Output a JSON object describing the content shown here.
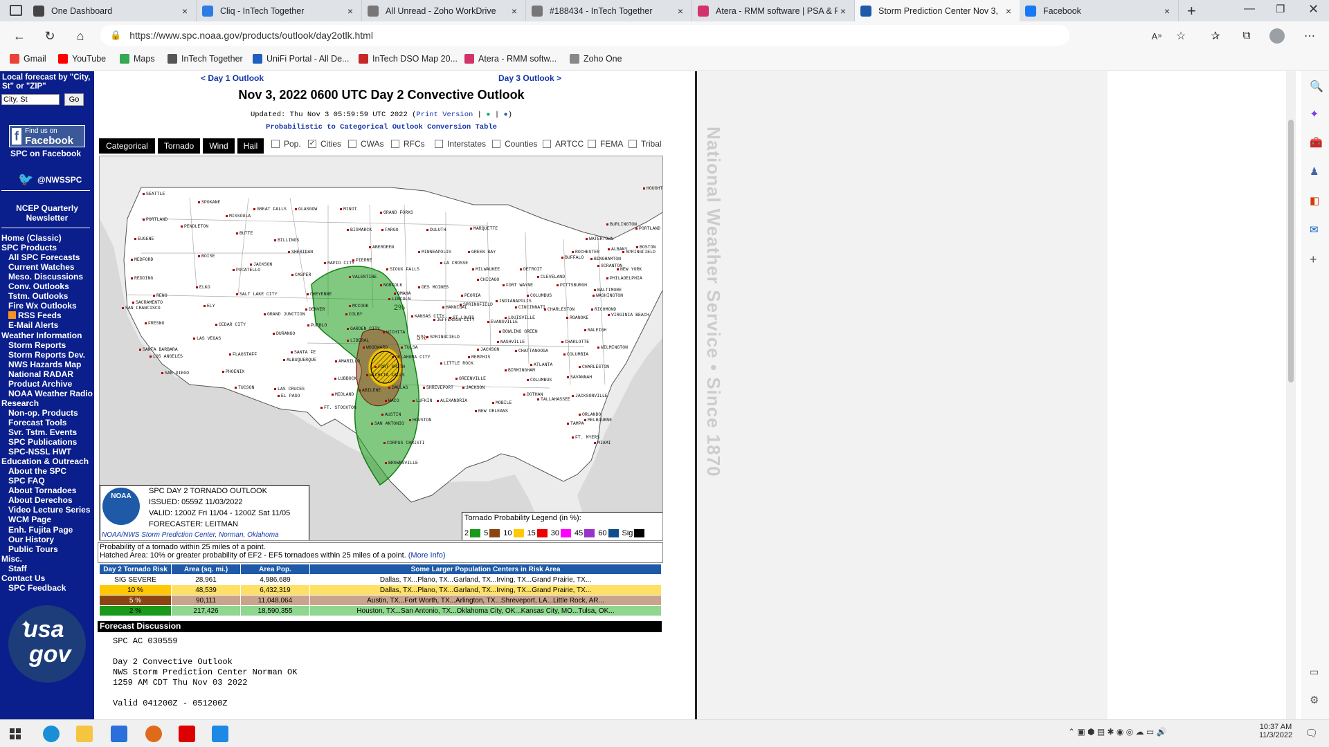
{
  "tabs": [
    {
      "title": "One Dashboard",
      "color": "#444"
    },
    {
      "title": "Cliq - InTech Together",
      "color": "#2d7be5"
    },
    {
      "title": "All Unread - Zoho WorkDrive",
      "color": "#777"
    },
    {
      "title": "#188434 - InTech Together",
      "color": "#777"
    },
    {
      "title": "Atera - RMM software | PSA & R",
      "color": "#d2336b"
    },
    {
      "title": "Storm Prediction Center Nov 3,",
      "color": "#1e5aa8"
    },
    {
      "title": "Facebook",
      "color": "#1877f2"
    }
  ],
  "url": "https://www.spc.noaa.gov/products/outlook/day2otlk.html",
  "bookmarks": [
    {
      "label": "Gmail",
      "color": "#ea4335"
    },
    {
      "label": "YouTube",
      "color": "#ff0000"
    },
    {
      "label": "Maps",
      "color": "#34a853"
    },
    {
      "label": "InTech Together",
      "color": "#555"
    },
    {
      "label": "UniFi Portal - All De...",
      "color": "#1f5fbf"
    },
    {
      "label": "InTech DSO Map 20...",
      "color": "#c62828"
    },
    {
      "label": "Atera - RMM softw...",
      "color": "#d2336b"
    },
    {
      "label": "Zoho One",
      "color": "#888"
    }
  ],
  "leftnav": {
    "local_label": "Local forecast by \"City, St\" or \"ZIP\"",
    "search_value": "City, St",
    "go": "Go",
    "fb_line1": "Find us on",
    "fb_line2": "Facebook",
    "fb_caption": "SPC on Facebook",
    "twitter": "@NWSSPC",
    "ncep1": "NCEP Quarterly",
    "ncep2": "Newsletter",
    "items": [
      {
        "t": "Home (Classic)",
        "i": 0
      },
      {
        "t": "SPC Products",
        "i": 0
      },
      {
        "t": "All SPC Forecasts",
        "i": 1
      },
      {
        "t": "Current Watches",
        "i": 1
      },
      {
        "t": "Meso. Discussions",
        "i": 1
      },
      {
        "t": "Conv. Outlooks",
        "i": 1
      },
      {
        "t": "Tstm. Outlooks",
        "i": 1
      },
      {
        "t": "Fire Wx Outlooks",
        "i": 1
      },
      {
        "t": "RSS Feeds",
        "i": 1
      },
      {
        "t": "E-Mail Alerts",
        "i": 1
      },
      {
        "t": "Weather Information",
        "i": 0
      },
      {
        "t": "Storm Reports",
        "i": 1
      },
      {
        "t": "Storm Reports Dev.",
        "i": 1
      },
      {
        "t": "NWS Hazards Map",
        "i": 1
      },
      {
        "t": "National RADAR",
        "i": 1
      },
      {
        "t": "Product Archive",
        "i": 1
      },
      {
        "t": "NOAA Weather Radio",
        "i": 1
      },
      {
        "t": "Research",
        "i": 0
      },
      {
        "t": "Non-op. Products",
        "i": 1
      },
      {
        "t": "Forecast Tools",
        "i": 1
      },
      {
        "t": "Svr. Tstm. Events",
        "i": 1
      },
      {
        "t": "SPC Publications",
        "i": 1
      },
      {
        "t": "SPC-NSSL HWT",
        "i": 1
      },
      {
        "t": "Education & Outreach",
        "i": 0
      },
      {
        "t": "About the SPC",
        "i": 1
      },
      {
        "t": "SPC FAQ",
        "i": 1
      },
      {
        "t": "About Tornadoes",
        "i": 1
      },
      {
        "t": "About Derechos",
        "i": 1
      },
      {
        "t": "Video Lecture Series",
        "i": 1
      },
      {
        "t": "WCM Page",
        "i": 1
      },
      {
        "t": "Enh. Fujita Page",
        "i": 1
      },
      {
        "t": "Our History",
        "i": 1
      },
      {
        "t": "Public Tours",
        "i": 1
      },
      {
        "t": "Misc.",
        "i": 0
      },
      {
        "t": "Staff",
        "i": 1
      },
      {
        "t": "Contact Us",
        "i": 0
      },
      {
        "t": "SPC Feedback",
        "i": 1
      }
    ],
    "usagov1": "usa",
    "usagov2": "gov"
  },
  "main": {
    "prev": "< Day 1 Outlook",
    "next": "Day 3 Outlook >",
    "title": "Nov 3, 2022 0600 UTC Day 2 Convective Outlook",
    "updated": "Updated: Thu Nov 3 05:59:59 UTC 2022 (",
    "print": "Print Version",
    "conv": "Probabilistic to Categorical Outlook Conversion Table",
    "buttons": [
      "Categorical",
      "Tornado",
      "Wind",
      "Hail"
    ],
    "checks": [
      {
        "label": "Pop.",
        "checked": false
      },
      {
        "label": "Cities",
        "checked": true
      },
      {
        "label": "CWAs",
        "checked": false
      },
      {
        "label": "RFCs",
        "checked": false
      },
      {
        "label": "Interstates",
        "checked": false
      },
      {
        "label": "Counties",
        "checked": false
      },
      {
        "label": "ARTCC",
        "checked": false
      },
      {
        "label": "FEMA",
        "checked": false
      },
      {
        "label": "Tribal",
        "checked": false
      }
    ],
    "infobox": {
      "l1": "SPC DAY 2 TORNADO OUTLOOK",
      "l2": "ISSUED: 0559Z 11/03/2022",
      "l3": "VALID: 1200Z Fri 11/04 - 1200Z Sat 11/05",
      "l4": "FORECASTER: LEITMAN",
      "l5": "NOAA/NWS Storm Prediction Center, Norman, Oklahoma",
      "noaa": "NOAA"
    },
    "legend": {
      "title": "Tornado Probability Legend (in %):",
      "items": [
        {
          "v": "2",
          "c": "#1a9a1a"
        },
        {
          "v": "5",
          "c": "#8b4513"
        },
        {
          "v": "10",
          "c": "#ffc800"
        },
        {
          "v": "15",
          "c": "#ee0000"
        },
        {
          "v": "30",
          "c": "#ff00ff"
        },
        {
          "v": "45",
          "c": "#9932cc"
        },
        {
          "v": "60",
          "c": "#104e8b"
        },
        {
          "v": "Sig",
          "c": "#000000"
        }
      ]
    },
    "map_labels": {
      "p2": "2%",
      "p5": "5%"
    },
    "desc1": "Probability of a tornado within 25 miles of a point.",
    "desc2": "Hatched Area: 10% or greater probability of EF2 - EF5 tornadoes within 25 miles of a point.",
    "more": "(More Info)",
    "table": {
      "headers": [
        "Day 2 Tornado Risk",
        "Area (sq. mi.)",
        "Area Pop.",
        "Some Larger Population Centers in Risk Area"
      ],
      "rows": [
        {
          "risk": "SIG SEVERE",
          "area": "28,961",
          "pop": "4,986,689",
          "centers": "Dallas, TX...Plano, TX...Garland, TX...Irving, TX...Grand Prairie, TX...",
          "bg": "#ffffff",
          "fg": "#000"
        },
        {
          "risk": "10 %",
          "area": "48,539",
          "pop": "6,432,319",
          "centers": "Dallas, TX...Plano, TX...Garland, TX...Irving, TX...Grand Prairie, TX...",
          "bg": "#ffe066",
          "fg": "#000"
        },
        {
          "risk": "5 %",
          "area": "90,111",
          "pop": "11,048,064",
          "centers": "Austin, TX...Fort Worth, TX...Arlington, TX...Shreveport, LA...Little Rock, AR...",
          "bg": "#c8a48c",
          "fg": "#000"
        },
        {
          "risk": "2 %",
          "area": "217,426",
          "pop": "18,590,355",
          "centers": "Houston, TX...San Antonio, TX...Oklahoma City, OK...Kansas City, MO...Tulsa, OK...",
          "bg": "#8fd68f",
          "fg": "#000"
        }
      ],
      "riskcolors": [
        "#ffffff",
        "#ffc800",
        "#8b4513",
        "#1a9a1a"
      ]
    },
    "disc_head": "Forecast Discussion",
    "disc": [
      "SPC AC 030559",
      "",
      "Day 2 Convective Outlook",
      "NWS Storm Prediction Center Norman OK",
      "1259 AM CDT Thu Nov 03 2022",
      "",
      "Valid 041200Z - 051200Z"
    ],
    "vertical": "National Weather Service • Since 1870"
  },
  "cities": [
    [
      "SEATTLE",
      210,
      178
    ],
    [
      "SPOKANE",
      290,
      190
    ],
    [
      "MISSOULA",
      330,
      210
    ],
    [
      "GREAT FALLS",
      370,
      200
    ],
    [
      "GLASGOW",
      430,
      200
    ],
    [
      "MINOT",
      495,
      200
    ],
    [
      "GRAND FORKS",
      553,
      205
    ],
    [
      "HOUGHTON",
      933,
      170
    ],
    [
      "PORTLAND",
      210,
      215
    ],
    [
      "PENDLETON",
      265,
      225
    ],
    [
      "BUTTE",
      345,
      235
    ],
    [
      "BILLINGS",
      400,
      245
    ],
    [
      "BISMARCK",
      505,
      230
    ],
    [
      "FARGO",
      555,
      230
    ],
    [
      "DULUTH",
      620,
      230
    ],
    [
      "MARQUETTE",
      683,
      228
    ],
    [
      "BURLINGTON",
      880,
      222
    ],
    [
      "PORTLAND",
      922,
      228
    ],
    [
      "EUGENE",
      198,
      243
    ],
    [
      "SHERIDAN",
      420,
      262
    ],
    [
      "ABERDEEN",
      537,
      255
    ],
    [
      "GREEN BAY",
      680,
      262
    ],
    [
      "WATERTOWN",
      850,
      243
    ],
    [
      "BOSTON",
      923,
      255
    ],
    [
      "MEDFORD",
      193,
      273
    ],
    [
      "BOISE",
      290,
      268
    ],
    [
      "JACKSON",
      365,
      280
    ],
    [
      "POCATELLO",
      340,
      288
    ],
    [
      "RAPID CITY",
      472,
      278
    ],
    [
      "PIERRE",
      513,
      274
    ],
    [
      "MINNEAPOLIS",
      608,
      262
    ],
    [
      "ROCHESTER",
      830,
      262
    ],
    [
      "ALBANY",
      882,
      258
    ],
    [
      "SPRINGFIELD",
      903,
      262
    ],
    [
      "BUFFALO",
      815,
      270
    ],
    [
      "BINGHAMTON",
      857,
      272
    ],
    [
      "SIOUX FALLS",
      562,
      287
    ],
    [
      "LA CROSSE",
      640,
      278
    ],
    [
      "MILWAUKEE",
      686,
      287
    ],
    [
      "DETROIT",
      755,
      287
    ],
    [
      "SCRANTON",
      867,
      282
    ],
    [
      "NEW YORK",
      895,
      287
    ],
    [
      "REDDING",
      193,
      300
    ],
    [
      "CASPER",
      425,
      295
    ],
    [
      "VALENTINE",
      508,
      298
    ],
    [
      "CLEVELAND",
      780,
      298
    ],
    [
      "PHILADELPHIA",
      880,
      300
    ],
    [
      "ELKO",
      287,
      313
    ],
    [
      "NORFOLK",
      553,
      310
    ],
    [
      "DES MOINES",
      608,
      313
    ],
    [
      "CHICAGO",
      693,
      302
    ],
    [
      "FORT WAYNE",
      730,
      310
    ],
    [
      "PITTSBURGH",
      808,
      310
    ],
    [
      "BALTIMORE",
      862,
      317
    ],
    [
      "WASHINGTON",
      860,
      325
    ],
    [
      "RENO",
      225,
      325
    ],
    [
      "SALT LAKE CITY",
      345,
      323
    ],
    [
      "CHEYENNE",
      447,
      323
    ],
    [
      "OMAHA",
      573,
      322
    ],
    [
      "LINCOLN",
      565,
      330
    ],
    [
      "PEORIA",
      670,
      325
    ],
    [
      "COLUMBUS",
      765,
      325
    ],
    [
      "SACRAMENTO",
      195,
      335
    ],
    [
      "ELY",
      298,
      340
    ],
    [
      "MCCOOK",
      508,
      340
    ],
    [
      "SPRINGFIELD",
      668,
      338
    ],
    [
      "INDIANAPOLIS",
      720,
      333
    ],
    [
      "CINCINNATI",
      748,
      342
    ],
    [
      "HANNIBAL",
      643,
      342
    ],
    [
      "RICHMOND",
      858,
      345
    ],
    [
      "SAN FRANCISCO",
      180,
      343
    ],
    [
      "DENVER",
      445,
      345
    ],
    [
      "CHARLESTON",
      790,
      345
    ],
    [
      "VIRGINIA BEACH",
      882,
      353
    ],
    [
      "GRAND JUNCTION",
      385,
      352
    ],
    [
      "COLBY",
      503,
      352
    ],
    [
      "KANSAS CITY",
      598,
      355
    ],
    [
      "ST LOUIS",
      653,
      357
    ],
    [
      "LOUISVILLE",
      733,
      357
    ],
    [
      "EVANSVILLE",
      708,
      363
    ],
    [
      "ROANOKE",
      822,
      357
    ],
    [
      "FRESNO",
      213,
      365
    ],
    [
      "CEDAR CITY",
      315,
      367
    ],
    [
      "PUEBLO",
      448,
      368
    ],
    [
      "GARDEN CITY",
      505,
      373
    ],
    [
      "JEFFERSON CITY",
      630,
      360
    ],
    [
      "WICHITA",
      557,
      378
    ],
    [
      "SPRINGFIELD",
      620,
      385
    ],
    [
      "BOWLING GREEN",
      725,
      377
    ],
    [
      "RALEIGH",
      848,
      375
    ],
    [
      "DURANGO",
      398,
      380
    ],
    [
      "LAS VEGAS",
      283,
      387
    ],
    [
      "LIBERAL",
      505,
      390
    ],
    [
      "NASHVILLE",
      722,
      392
    ],
    [
      "CHARLOTTE",
      815,
      392
    ],
    [
      "WILMINGTON",
      867,
      400
    ],
    [
      "SANTA FE",
      424,
      407
    ],
    [
      "TULSA",
      583,
      400
    ],
    [
      "WOODWARD",
      528,
      400
    ],
    [
      "JACKSON",
      693,
      403
    ],
    [
      "CHATTANOOGA",
      748,
      405
    ],
    [
      "FLAGSTAFF",
      335,
      410
    ],
    [
      "SANTA BARBARA",
      205,
      403
    ],
    [
      "LOS ANGELES",
      220,
      413
    ],
    [
      "ALBUQUERQUE",
      413,
      418
    ],
    [
      "AMARILLO",
      488,
      420
    ],
    [
      "OKLAHOMA CITY",
      570,
      414
    ],
    [
      "MEMPHIS",
      680,
      414
    ],
    [
      "COLUMBIA",
      818,
      410
    ],
    [
      "ATLANTA",
      770,
      425
    ],
    [
      "LITTLE ROCK",
      640,
      423
    ],
    [
      "CHARLESTON",
      840,
      428
    ],
    [
      "FORT SMITH",
      545,
      428
    ],
    [
      "PHOENIX",
      325,
      435
    ],
    [
      "SAN DIEGO",
      237,
      437
    ],
    [
      "BIRMINGHAM",
      733,
      433
    ],
    [
      "SAVANNAH",
      823,
      443
    ],
    [
      "WICHITA FALLS",
      533,
      440
    ],
    [
      "LUBBOCK",
      487,
      445
    ],
    [
      "GREENVILLE",
      662,
      445
    ],
    [
      "COLUMBUS",
      765,
      447
    ],
    [
      "TUCSON",
      343,
      458
    ],
    [
      "LAS CRUCES",
      400,
      460
    ],
    [
      "DALLAS",
      565,
      458
    ],
    [
      "SHREVEPORT",
      615,
      458
    ],
    [
      "JACKSON",
      672,
      458
    ],
    [
      "EL PASO",
      405,
      470
    ],
    [
      "ABILENE",
      522,
      462
    ],
    [
      "MIDLAND",
      483,
      468
    ],
    [
      "DOTHAN",
      760,
      468
    ],
    [
      "TALLAHASSEE",
      780,
      475
    ],
    [
      "JACKSONVILLE",
      830,
      470
    ],
    [
      "WACO",
      560,
      477
    ],
    [
      "LUFKIN",
      600,
      477
    ],
    [
      "ALEXANDRIA",
      635,
      477
    ],
    [
      "MOBILE",
      715,
      480
    ],
    [
      "FT. STOCKTON",
      467,
      487
    ],
    [
      "AUSTIN",
      555,
      497
    ],
    [
      "NEW ORLEANS",
      690,
      492
    ],
    [
      "HOUSTON",
      595,
      505
    ],
    [
      "SAN ANTONIO",
      540,
      510
    ],
    [
      "ORLANDO",
      840,
      497
    ],
    [
      "MELBOURNE",
      848,
      505
    ],
    [
      "TAMPA",
      823,
      510
    ],
    [
      "CORPUS CHRISTI",
      558,
      538
    ],
    [
      "FT. MYERS",
      830,
      530
    ],
    [
      "MIAMI",
      862,
      538
    ],
    [
      "BROWNSVILLE",
      560,
      567
    ]
  ]
}
